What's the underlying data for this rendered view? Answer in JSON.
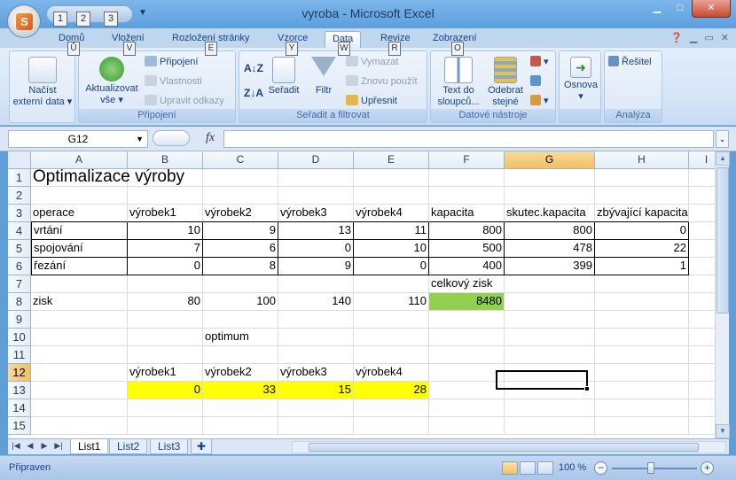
{
  "window": {
    "title": "vyroba - Microsoft Excel"
  },
  "qat_keys": [
    "1",
    "2",
    "3"
  ],
  "tabs": [
    {
      "label": "Domů",
      "key": "Ů",
      "active": false
    },
    {
      "label": "Vložení",
      "key": "V",
      "active": false
    },
    {
      "label": "Rozložení stránky",
      "key": "E",
      "active": false
    },
    {
      "label": "Vzorce",
      "key": "Y",
      "active": false
    },
    {
      "label": "Data",
      "key": "W",
      "active": true
    },
    {
      "label": "Revize",
      "key": "R",
      "active": false
    },
    {
      "label": "Zobrazení",
      "key": "O",
      "active": false
    }
  ],
  "ribbon": {
    "group_pripojeni": {
      "label": "Připojení",
      "nacist_line1": "Načíst",
      "nacist_line2": "externí data",
      "aktualizovat_line1": "Aktualizovat",
      "aktualizovat_line2": "vše",
      "pripojeni": "Připojení",
      "vlastnosti": "Vlastnosti",
      "upravit_odkazy": "Upravit odkazy"
    },
    "group_seradit": {
      "label": "Seřadit a filtrovat",
      "seradit": "Seřadit",
      "filtr": "Filtr",
      "vymazat": "Vymazat",
      "znovu_pouzit": "Znovu použít",
      "upresnit": "Upřesnit"
    },
    "group_datove": {
      "label": "Datové nástroje",
      "text_do_line1": "Text do",
      "text_do_line2": "sloupců...",
      "odebrat_line1": "Odebrat",
      "odebrat_line2": "stejné"
    },
    "group_osnova": {
      "osnova": "Osnova"
    },
    "group_analyza": {
      "label": "Analýza",
      "resitel": "Řešitel"
    }
  },
  "formula_bar": {
    "name_box": "G12",
    "fx": "fx",
    "formula": ""
  },
  "columns": [
    "A",
    "B",
    "C",
    "D",
    "E",
    "F",
    "G",
    "H",
    "I"
  ],
  "rows": [
    "1",
    "2",
    "3",
    "4",
    "5",
    "6",
    "7",
    "8",
    "9",
    "10",
    "11",
    "12",
    "13",
    "14",
    "15"
  ],
  "cells": {
    "A1": "Optimalizace výroby",
    "A3": "operace",
    "B3": "výrobek1",
    "C3": "výrobek2",
    "D3": "výrobek3",
    "E3": "výrobek4",
    "F3": "kapacita",
    "G3": "skutec.kapacita",
    "H3": "zbývající kapacita",
    "A4": "vrtání",
    "B4": "10",
    "C4": "9",
    "D4": "13",
    "E4": "11",
    "F4": "800",
    "G4": "800",
    "H4": "0",
    "A5": "spojování",
    "B5": "7",
    "C5": "6",
    "D5": "0",
    "E5": "10",
    "F5": "500",
    "G5": "478",
    "H5": "22",
    "A6": "řezání",
    "B6": "0",
    "C6": "8",
    "D6": "9",
    "E6": "0",
    "F6": "400",
    "G6": "399",
    "H6": "1",
    "F7": "celkový zisk",
    "A8": "zisk",
    "B8": "80",
    "C8": "100",
    "D8": "140",
    "E8": "110",
    "F8": "8480",
    "C10": "optimum",
    "B12": "výrobek1",
    "C12": "výrobek2",
    "D12": "výrobek3",
    "E12": "výrobek4",
    "B13": "0",
    "C13": "33",
    "D13": "15",
    "E13": "28"
  },
  "sheets": [
    {
      "label": "List1",
      "active": true
    },
    {
      "label": "List2",
      "active": false
    },
    {
      "label": "List3",
      "active": false
    }
  ],
  "status": {
    "ready": "Připraven",
    "zoom": "100 %"
  },
  "colors": {
    "yellow": "#ffff00",
    "green": "#92d050",
    "selected_header": "#f1c15f"
  }
}
